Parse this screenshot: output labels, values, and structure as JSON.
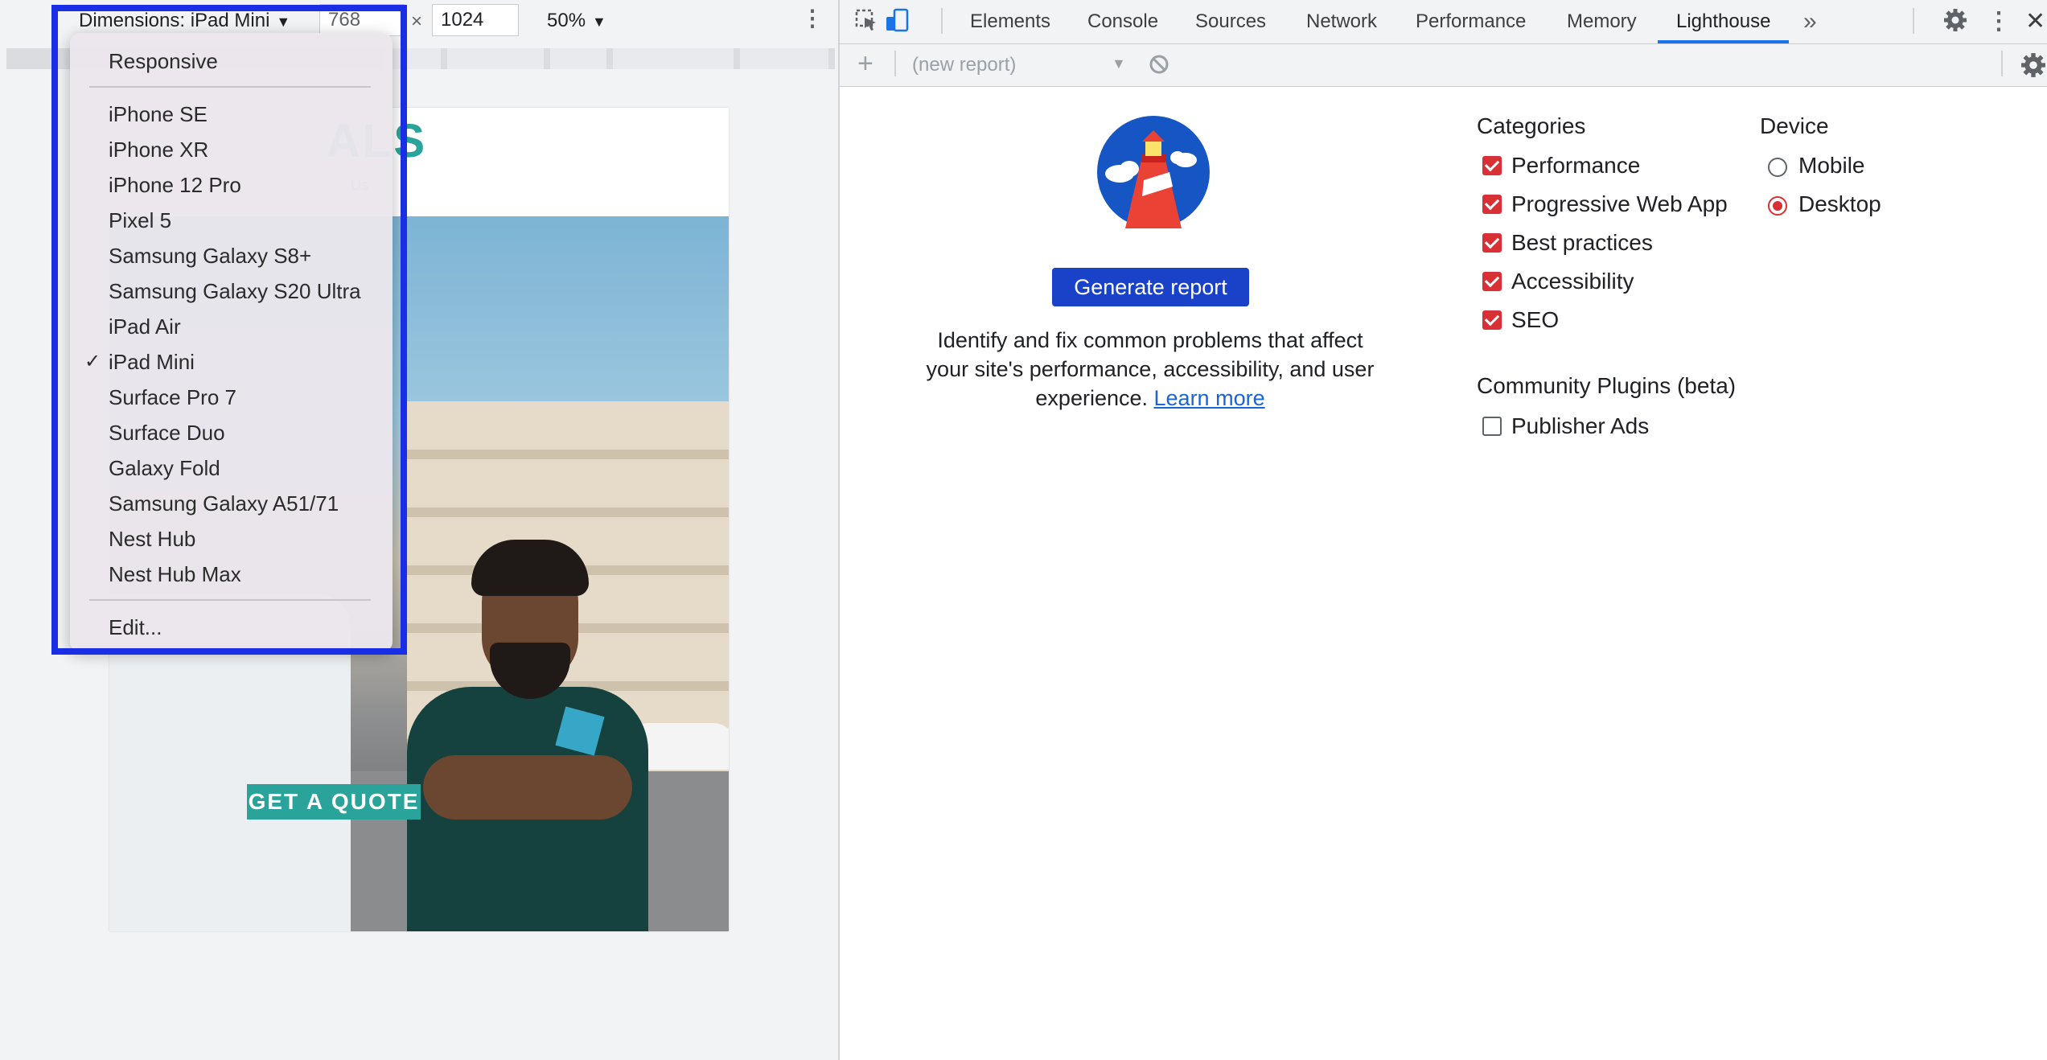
{
  "device_toolbar": {
    "dimensions_label": "Dimensions: iPad Mini",
    "width": "768",
    "times": "×",
    "height": "1024",
    "zoom": "50%"
  },
  "device_menu": {
    "responsive": "Responsive",
    "devices": [
      "iPhone SE",
      "iPhone XR",
      "iPhone 12 Pro",
      "Pixel 5",
      "Samsung Galaxy S8+",
      "Samsung Galaxy S20 Ultra",
      "iPad Air",
      "iPad Mini",
      "Surface Pro 7",
      "Surface Duo",
      "Galaxy Fold",
      "Samsung Galaxy A51/71",
      "Nest Hub",
      "Nest Hub Max"
    ],
    "selected": "iPad Mini",
    "check": "✓",
    "edit": "Edit..."
  },
  "emulated_site": {
    "logo_fragment": "ALS",
    "tagline_fragment": "Us",
    "cta": "GET A QUOTE"
  },
  "devtools": {
    "tabs": [
      "Elements",
      "Console",
      "Sources",
      "Network",
      "Performance",
      "Memory",
      "Lighthouse"
    ],
    "active_tab": "Lighthouse",
    "more_tabs": "»",
    "report_select": "(new report)",
    "add": "+"
  },
  "lighthouse": {
    "generate_button": "Generate report",
    "description": "Identify and fix common problems that affect your site's performance, accessibility, and user experience.",
    "learn_more": "Learn more",
    "categories_title": "Categories",
    "categories": [
      {
        "label": "Performance",
        "checked": true
      },
      {
        "label": "Progressive Web App",
        "checked": true
      },
      {
        "label": "Best practices",
        "checked": true
      },
      {
        "label": "Accessibility",
        "checked": true
      },
      {
        "label": "SEO",
        "checked": true
      }
    ],
    "device_title": "Device",
    "devices": [
      {
        "label": "Mobile",
        "selected": false
      },
      {
        "label": "Desktop",
        "selected": true
      }
    ],
    "plugins_title": "Community Plugins (beta)",
    "plugins": [
      {
        "label": "Publisher Ads",
        "checked": false
      }
    ]
  },
  "colors": {
    "accent_red": "#d93036",
    "button_blue": "#1a42c8",
    "tab_underline": "#1a73e8",
    "highlight_box": "#1a2ee6",
    "site_teal": "#2aa39a"
  }
}
